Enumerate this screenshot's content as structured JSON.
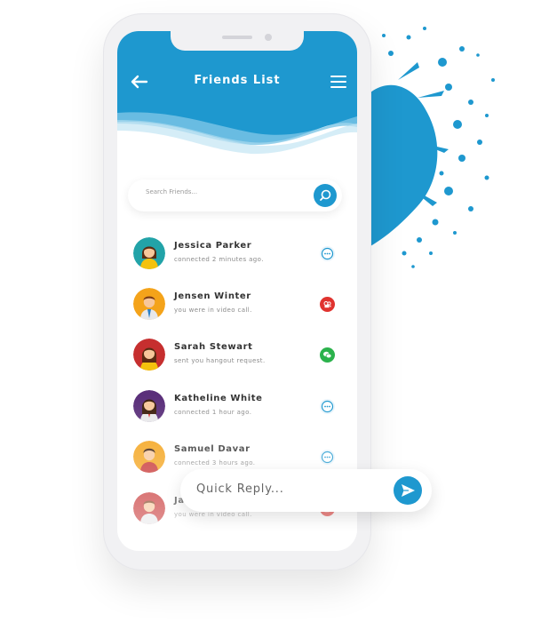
{
  "header": {
    "title": "Friends List",
    "color": "#1e98cf"
  },
  "search": {
    "placeholder": "Search Friends..."
  },
  "friends": [
    {
      "name": "Jessica Parker",
      "status": "connected 2 minutes ago.",
      "action": "message-icon",
      "action_color": "#1e98cf"
    },
    {
      "name": "Jensen Winter",
      "status": "you were in video call.",
      "action": "video-call-icon",
      "action_color": "#e0332f"
    },
    {
      "name": "Sarah Stewart",
      "status": "sent you hangout request.",
      "action": "hangout-icon",
      "action_color": "#2bb24c"
    },
    {
      "name": "Katheline White",
      "status": "connected 1 hour ago.",
      "action": "message-icon",
      "action_color": "#1e98cf"
    },
    {
      "name": "Samuel Davar",
      "status": "connected 3 hours ago.",
      "action": "message-icon",
      "action_color": "#1e98cf"
    },
    {
      "name": "Ja",
      "status": "you were in video call.",
      "action": "video-call-icon",
      "action_color": "#e0332f"
    }
  ],
  "quick_reply": {
    "placeholder": "Quick Reply..."
  },
  "colors": {
    "accent": "#1e98cf",
    "text": "#333333",
    "muted": "#8a8a8a"
  }
}
